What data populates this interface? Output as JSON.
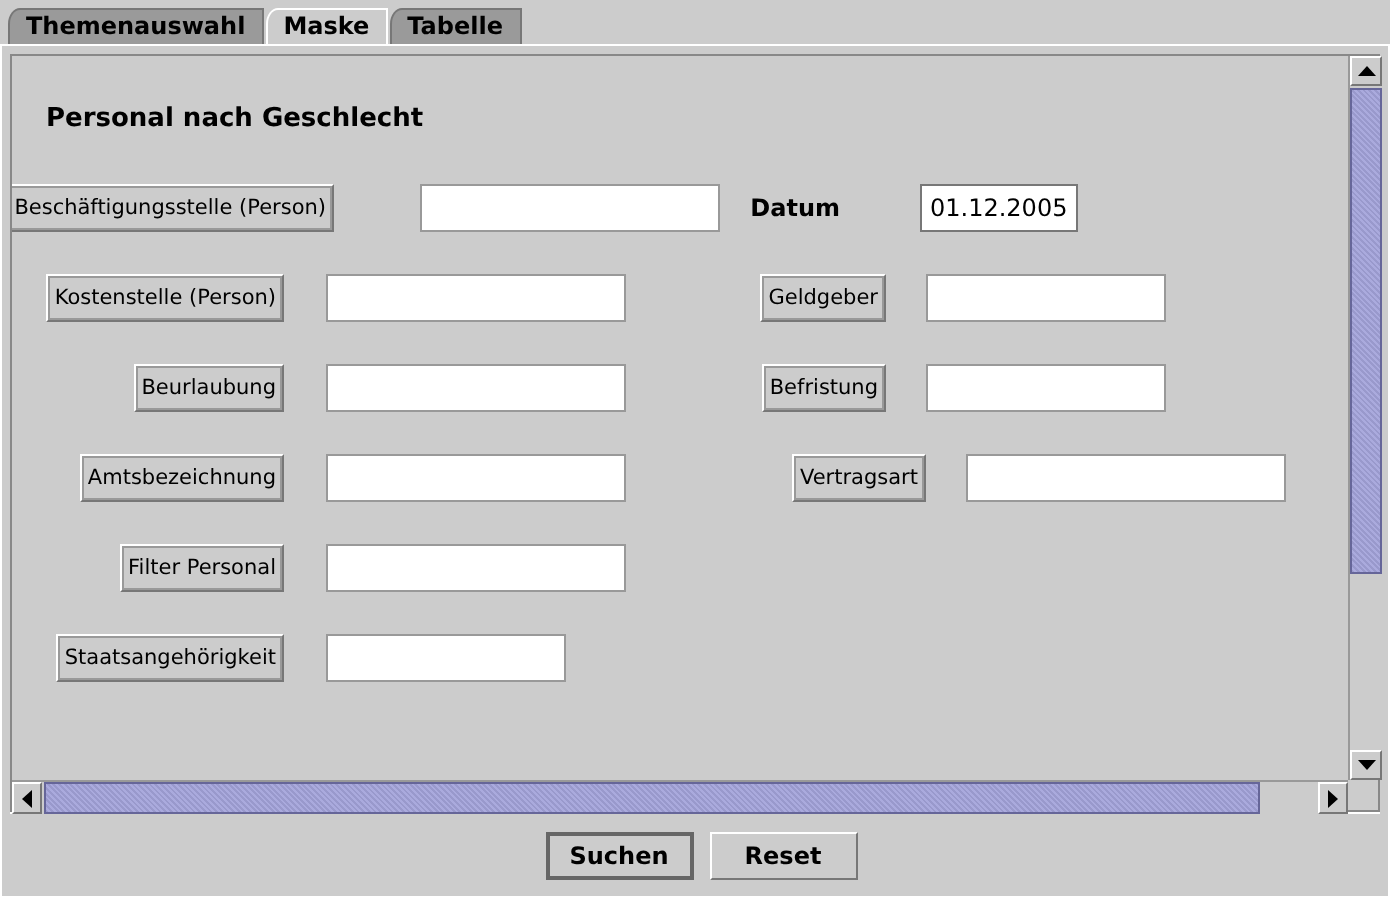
{
  "tabs": [
    {
      "label": "Themenauswahl",
      "selected": false
    },
    {
      "label": "Maske",
      "selected": true
    },
    {
      "label": "Tabelle",
      "selected": false
    }
  ],
  "form": {
    "title": "Personal nach Geschlecht",
    "rows": [
      {
        "cells": [
          {
            "kind": "button",
            "label": "Beschäftigungsstelle (Person)"
          },
          {
            "kind": "text",
            "label": "Datum",
            "value": "01.12.2005"
          }
        ]
      },
      {
        "cells": [
          {
            "kind": "button",
            "label": "Kostenstelle (Person)"
          },
          {
            "kind": "button",
            "label": "Geldgeber"
          }
        ]
      },
      {
        "cells": [
          {
            "kind": "button",
            "label": "Beurlaubung"
          },
          {
            "kind": "button",
            "label": "Befristung"
          }
        ]
      },
      {
        "cells": [
          {
            "kind": "button",
            "label": "Amtsbezeichnung"
          },
          {
            "kind": "button",
            "label": "Vertragsart"
          }
        ]
      },
      {
        "cells": [
          {
            "kind": "button",
            "label": "Filter Personal"
          }
        ]
      },
      {
        "cells": [
          {
            "kind": "button",
            "label": "Staatsangehörigkeit"
          }
        ]
      }
    ]
  },
  "buttons": [
    {
      "label": "Suchen",
      "default": true
    },
    {
      "label": "Reset",
      "default": false
    }
  ]
}
